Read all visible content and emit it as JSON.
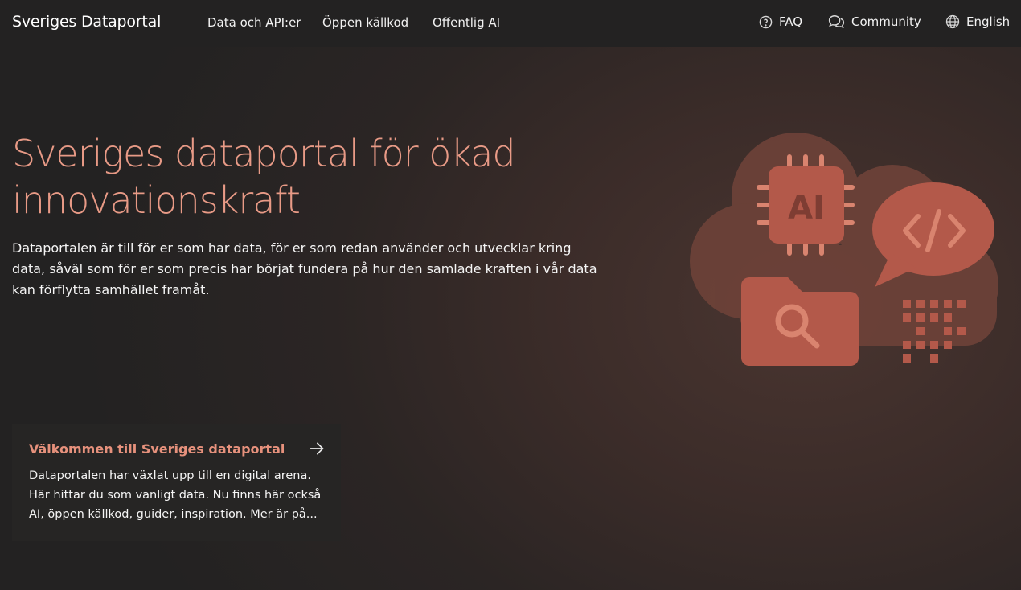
{
  "header": {
    "brand": "Sveriges Dataportal",
    "nav": [
      "Data och API:er",
      "Öppen källkod",
      "Offentlig AI"
    ],
    "faq": "FAQ",
    "community": "Community",
    "language": "English"
  },
  "hero": {
    "title_line1": "Sveriges dataportal för ökad",
    "title_line2": "innovationskraft",
    "description": "Dataportalen är till för er som har data, för er som redan använder och utvecklar kring data, såväl som för er som precis har börjat fundera på hur den samlade kraften i vår data kan förflytta samhället framåt.",
    "illustration_label": "AI"
  },
  "card": {
    "title": "Välkommen till Sveriges dataportal",
    "text": "Dataportalen har växlat upp till en digital arena. Här hittar du som vanligt data. Nu finns här också AI, öppen källkod, guider, inspiration. Mer är på..."
  },
  "colors": {
    "accent": "#e89a86",
    "illustration_dark": "#7a4a40",
    "illustration_mid": "#b0584a",
    "illustration_light": "#d4826f"
  },
  "icons": [
    "question-circle-icon",
    "chat-bubbles-icon",
    "globe-icon",
    "arrow-right-icon"
  ]
}
